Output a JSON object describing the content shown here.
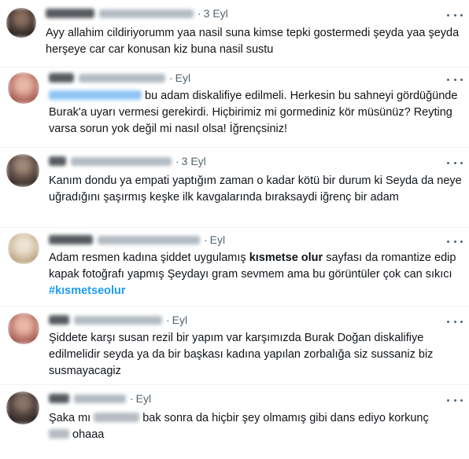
{
  "tweets": [
    {
      "date": "3 Eyl",
      "text": "Ayy allahim cildiriyorumm yaa nasil suna kimse tepki gostermedi şeyda yaa şeyda herşeye car car konusan kiz buna nasil sustu",
      "avatar_colors": [
        "#2a2220",
        "#5b4a40",
        "#8a6e5e"
      ]
    },
    {
      "date": "Eyl",
      "text_after_mention": " bu adam diskalifiye edilmeli. Herkesin bu sahneyi gördüğünde Burak'a uyarı vermesi gerekirdi. Hiçbirimiz mi gormediniz kör müsünüz? Reyting varsa sorun yok değil mi nasıl olsa! İğrençsiniz!",
      "avatar_colors": [
        "#c98a7e",
        "#e8b7a4",
        "#9b4f45"
      ]
    },
    {
      "date": "3 Eyl",
      "text": "Kanım dondu ya empati yaptığım zaman o kadar kötü bir durum ki Seyda da neye uğradığını şaşırmış keşke ilk kavgalarında bıraksaydi iğrenç bir adam",
      "avatar_colors": [
        "#3a302c",
        "#6d5a50",
        "#a08878"
      ]
    },
    {
      "date": "Eyl",
      "text_part1": "Adam resmen kadına şiddet uygulamış ",
      "bold_text": "kısmetse olur",
      "text_part2": " sayfası da romantize edip kapak fotoğrafı yapmış Şeydayı gram sevmem ama bu görüntüler çok can sıkıcı ",
      "hashtag": "#kısmetseolur",
      "avatar_colors": [
        "#d9c9b0",
        "#b59a78",
        "#ece3d3"
      ]
    },
    {
      "date": "Eyl",
      "text": "Şiddete karşı susan rezil bir yapım var karşımızda Burak Doğan diskalifiye edilmelidir seyda ya da bir başkası kadına yapılan zorbalığa siz sussaniz biz susmayacagiz",
      "avatar_colors": [
        "#c98a7e",
        "#e8b7a4",
        "#9b4f45"
      ]
    },
    {
      "date": "Eyl",
      "text_part1": "Şaka mı ",
      "text_part2": " bak sonra da hiçbir şey olmamış gibi dans ediyo korkunç ",
      "text_part3": " ohaaa",
      "avatar_colors": [
        "#2e2624",
        "#5a4a44",
        "#8a7468"
      ]
    }
  ]
}
